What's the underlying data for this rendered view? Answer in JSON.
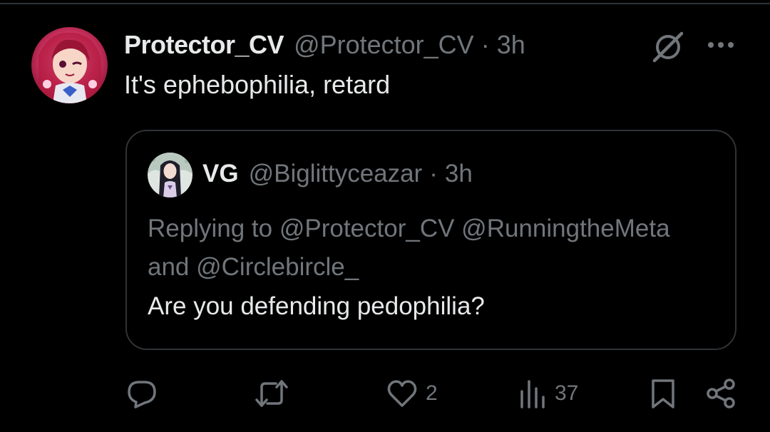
{
  "tweet": {
    "display_name": "Protector_CV",
    "handle": "@Protector_CV",
    "separator": "·",
    "time": "3h",
    "text": "It's ephebophilia, retard"
  },
  "quote": {
    "display_name": "VG",
    "handle": "@Biglittyceazar",
    "separator": "·",
    "time": "3h",
    "replying_to": "Replying to @Protector_CV @RunningtheMeta and @Circlebircle_",
    "text": "Are you defending pedophilia?"
  },
  "actions": {
    "reply_icon": "reply-icon",
    "retweet_icon": "retweet-icon",
    "like_icon": "like-icon",
    "like_count": "2",
    "views_icon": "views-icon",
    "views_count": "37",
    "bookmark_icon": "bookmark-icon",
    "share_icon": "share-icon"
  },
  "colors": {
    "background": "#000000",
    "primary_text": "#e7e9ea",
    "secondary_text": "#71767b",
    "border": "#2f3336"
  }
}
